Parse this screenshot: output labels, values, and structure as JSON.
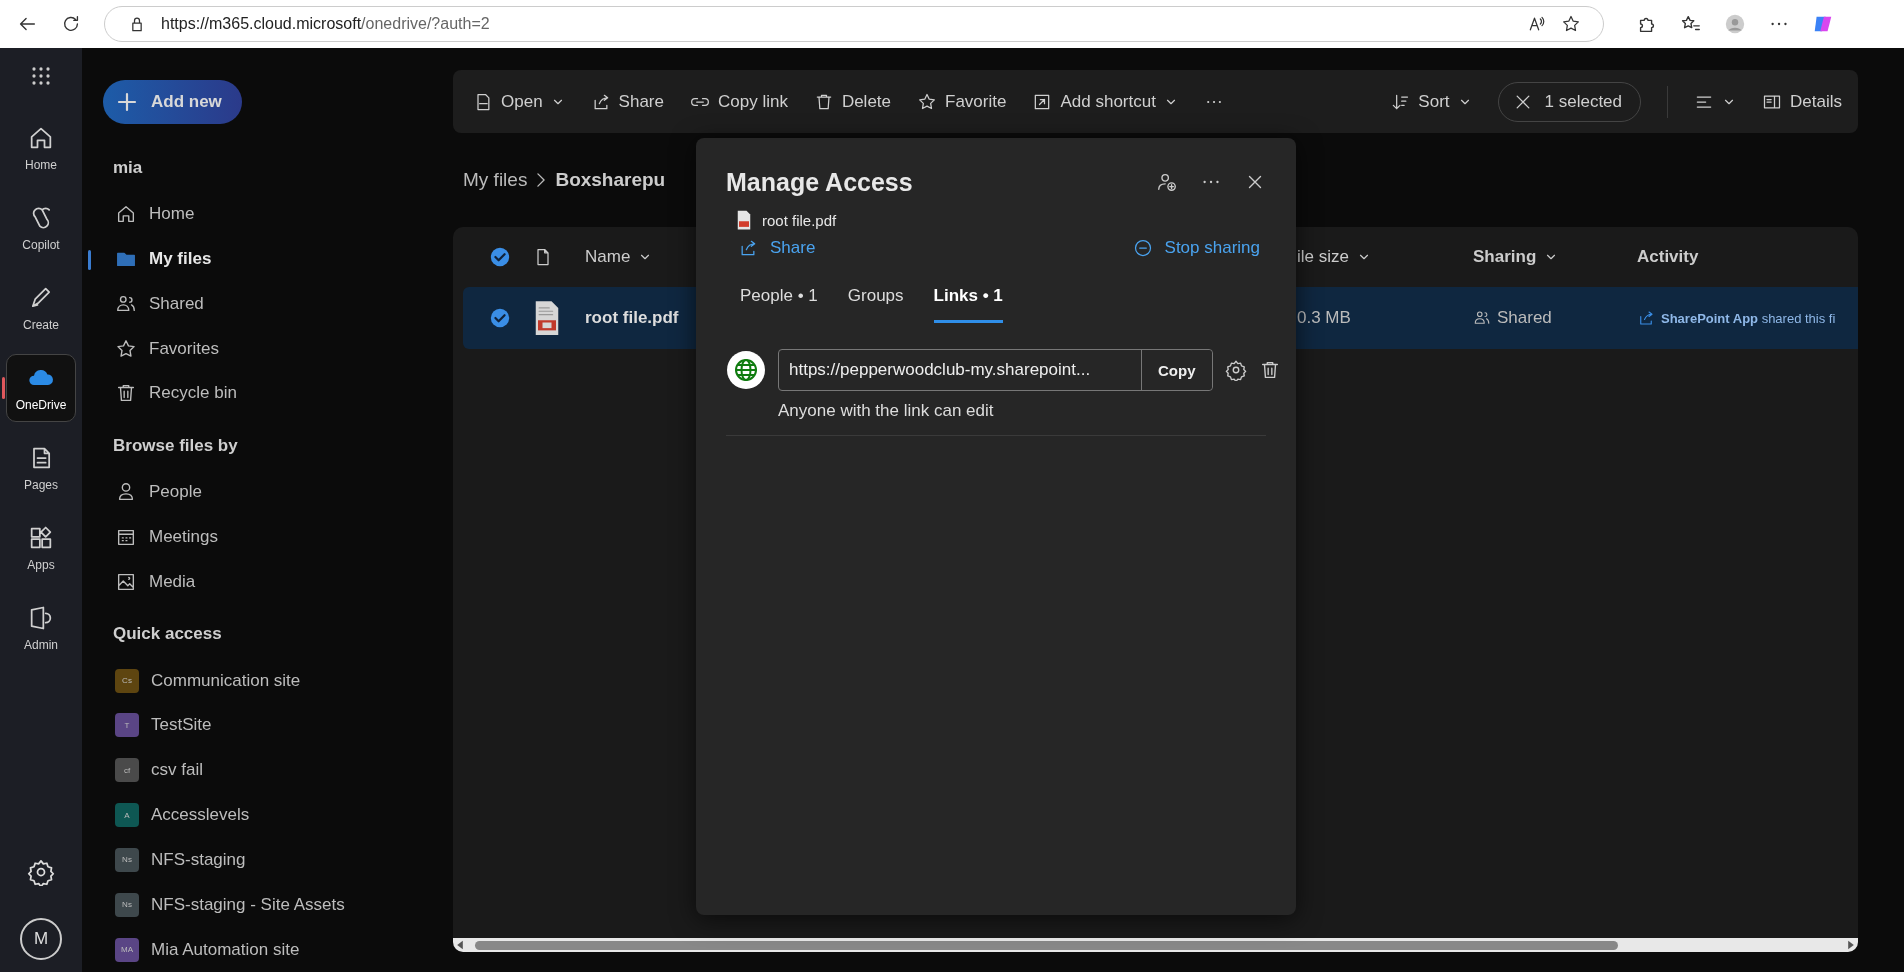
{
  "browser": {
    "url_host": "https://m365.cloud.microsoft",
    "url_path": "/onedrive/?auth=2"
  },
  "rail": {
    "items": [
      {
        "label": "Home",
        "selected": false
      },
      {
        "label": "Copilot",
        "selected": false
      },
      {
        "label": "Create",
        "selected": false
      },
      {
        "label": "OneDrive",
        "selected": true
      },
      {
        "label": "Pages",
        "selected": false
      },
      {
        "label": "Apps",
        "selected": false
      },
      {
        "label": "Admin",
        "selected": false
      }
    ],
    "avatar": "M"
  },
  "sidebar": {
    "add_new": "Add new",
    "user": "mia",
    "nav": [
      {
        "label": "Home",
        "selected": false
      },
      {
        "label": "My files",
        "selected": true
      },
      {
        "label": "Shared",
        "selected": false
      },
      {
        "label": "Favorites",
        "selected": false
      },
      {
        "label": "Recycle bin",
        "selected": false
      }
    ],
    "browse_heading": "Browse files by",
    "browse": [
      "People",
      "Meetings",
      "Media"
    ],
    "quick_heading": "Quick access",
    "quick": [
      {
        "initials": "Cs",
        "label": "Communication site",
        "color": "#5e4510"
      },
      {
        "initials": "T",
        "label": "TestSite",
        "color": "#5a4585"
      },
      {
        "initials": "cf",
        "label": "csv fail",
        "color": "#4a4a4a"
      },
      {
        "initials": "A",
        "label": "Accesslevels",
        "color": "#0e5753"
      },
      {
        "initials": "Ns",
        "label": "NFS-staging",
        "color": "#3e484c"
      },
      {
        "initials": "Ns",
        "label": "NFS-staging - Site Assets",
        "color": "#3e484c"
      },
      {
        "initials": "MA",
        "label": "Mia Automation site",
        "color": "#5a4585"
      }
    ]
  },
  "toolbar": {
    "actions": [
      {
        "label": "Open",
        "dropdown": true
      },
      {
        "label": "Share",
        "dropdown": false
      },
      {
        "label": "Copy link",
        "dropdown": false
      },
      {
        "label": "Delete",
        "dropdown": false
      },
      {
        "label": "Favorite",
        "dropdown": false
      },
      {
        "label": "Add shortcut",
        "dropdown": true
      }
    ],
    "sort": "Sort",
    "selection": "1 selected",
    "details": "Details"
  },
  "breadcrumb": [
    "My files",
    "Boxsharepu"
  ],
  "table": {
    "columns": [
      "Name",
      "ile size",
      "Sharing",
      "Activity"
    ],
    "rows": [
      {
        "selected": true,
        "name": "root file.pdf",
        "size": "0.3 MB",
        "sharing": "Shared",
        "activity": "**SharePoint App** shared this fi"
      }
    ]
  },
  "dialog": {
    "title": "Manage Access",
    "file": "root file.pdf",
    "share": "Share",
    "stop_sharing": "Stop sharing",
    "tabs": [
      {
        "label": "People • 1",
        "selected": false
      },
      {
        "label": "Groups",
        "selected": false
      },
      {
        "label": "Links • 1",
        "selected": true
      }
    ],
    "link": {
      "url": "https://pepperwoodclub-my.sharepoint...",
      "copy": "Copy",
      "description": "Anyone with the link can edit"
    }
  }
}
